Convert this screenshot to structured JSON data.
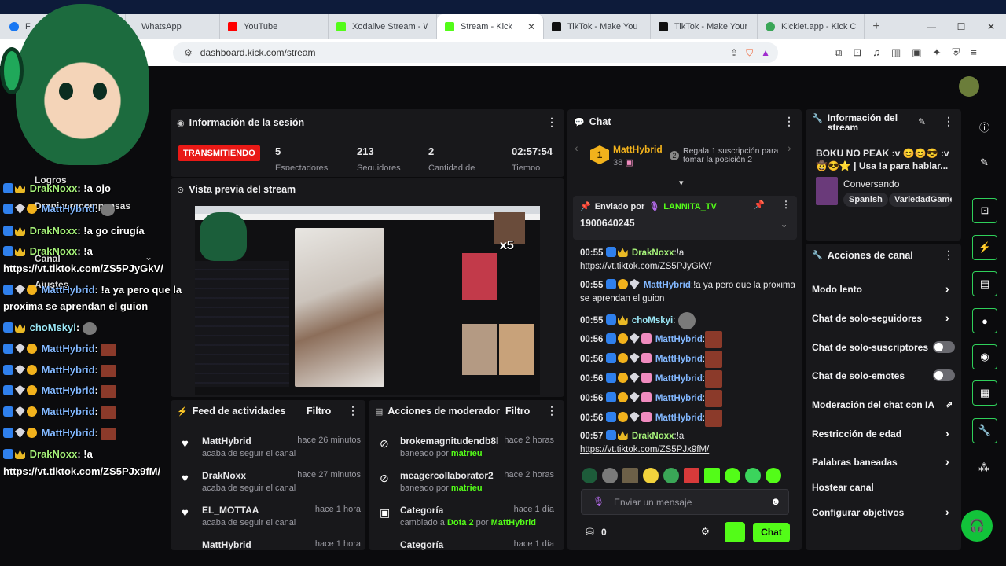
{
  "browser": {
    "tabs": [
      {
        "label": "F",
        "color": "#1877f2"
      },
      {
        "label": "WhatsApp",
        "color": "#25d366"
      },
      {
        "label": "YouTube",
        "color": "#ff0000"
      },
      {
        "label": "Xodalive Stream - Wa",
        "color": "#53fc18"
      },
      {
        "label": "Stream - Kick",
        "color": "#53fc18",
        "active": true
      },
      {
        "label": "TikTok - Make You",
        "color": "#111111"
      },
      {
        "label": "TikTok - Make Your D",
        "color": "#111111"
      },
      {
        "label": "Kicklet.app - Kick Cha",
        "color": "#3aa657"
      }
    ],
    "url": "dashboard.kick.com/stream"
  },
  "session": {
    "title": "Información de la sesión",
    "live_label": "TRANSMITIENDO",
    "stats": [
      {
        "value": "5",
        "label": "Espectadores"
      },
      {
        "value": "213",
        "label": "Seguidores"
      },
      {
        "value": "2",
        "label": "Cantidad de"
      },
      {
        "value": "02:57:54",
        "label": "Tiempo"
      }
    ]
  },
  "preview": {
    "title": "Vista previa del stream",
    "overlay_badge": "x5"
  },
  "activity": {
    "title": "Feed de actividades",
    "filter": "Filtro",
    "items": [
      {
        "name": "MattHybrid",
        "time": "hace 26 minutos",
        "desc": "acaba de seguir el canal"
      },
      {
        "name": "DrakNoxx",
        "time": "hace 27 minutos",
        "desc": "acaba de seguir el canal"
      },
      {
        "name": "EL_MOTTAA",
        "time": "hace 1 hora",
        "desc": "acaba de seguir el canal"
      },
      {
        "name": "MattHybrid",
        "time": "hace 1 hora",
        "desc": ""
      }
    ]
  },
  "mod": {
    "title": "Acciones de moderador",
    "filter": "Filtro",
    "items": [
      {
        "name": "brokemagnitudendb8l",
        "time": "hace 2 horas",
        "prefix": "baneado por ",
        "by": "matrieu",
        "extra": ""
      },
      {
        "name": "meagercollaborator2",
        "time": "hace 2 horas",
        "prefix": "baneado por ",
        "by": "matrieu",
        "extra": ""
      },
      {
        "name": "Categoría",
        "time": "hace 1 día",
        "prefix": "cambiado a ",
        "by": "Dota 2",
        "extra": " por ",
        "by2": "MattHybrid"
      },
      {
        "name": "Categoría",
        "time": "hace 1 día",
        "prefix": "",
        "by": "",
        "extra": ""
      }
    ]
  },
  "chat": {
    "title": "Chat",
    "top_gifter": {
      "name": "MattHybrid",
      "count": "38",
      "rank": "1"
    },
    "gift_msg": "Regala 1 suscripción para tomar la posición 2",
    "gift_rank": "2",
    "pinned": {
      "prefix": "Enviado por",
      "user": "LANNITA_TV",
      "text": "1900640245"
    },
    "messages": [
      {
        "time": "00:55",
        "user": "DrakNoxx",
        "text": ":!a",
        "link": "https://vt.tiktok.com/ZS5PJyGkV/"
      },
      {
        "time": "00:55",
        "user": "MattHybrid",
        "text": ":!a ya pero que la proxima se aprendan el guion"
      },
      {
        "time": "00:55",
        "user": "choMskyi",
        "text": ":"
      },
      {
        "time": "00:56",
        "user": "MattHybrid",
        "text": ":"
      },
      {
        "time": "00:56",
        "user": "MattHybrid",
        "text": ":"
      },
      {
        "time": "00:56",
        "user": "MattHybrid",
        "text": ":"
      },
      {
        "time": "00:56",
        "user": "MattHybrid",
        "text": ":"
      },
      {
        "time": "00:56",
        "user": "MattHybrid",
        "text": ":"
      },
      {
        "time": "00:57",
        "user": "DrakNoxx",
        "text": ":!a",
        "link": "https://vt.tiktok.com/ZS5PJx9fM/"
      }
    ],
    "placeholder": "Enviar un mensaje",
    "points": "0",
    "send": "Chat"
  },
  "stream_info": {
    "title": "Información del stream",
    "stream_title": "BOKU NO PEAK :v 😊😊😎 :v 🤠😎⭐ | Usa !a para hablar...",
    "category": "Conversando",
    "tags": [
      "Spanish",
      "VariedadGamer"
    ]
  },
  "channel_actions": {
    "title": "Acciones de canal",
    "items": [
      {
        "label": "Modo lento",
        "kind": "chevron"
      },
      {
        "label": "Chat de solo-seguidores",
        "kind": "chevron"
      },
      {
        "label": "Chat de solo-suscriptores",
        "kind": "toggle"
      },
      {
        "label": "Chat de solo-emotes",
        "kind": "toggle"
      },
      {
        "label": "Moderación del chat con IA",
        "kind": "external"
      },
      {
        "label": "Restricción de edad",
        "kind": "chevron"
      },
      {
        "label": "Palabras baneadas",
        "kind": "chevron"
      },
      {
        "label": "Hostear canal",
        "kind": "none"
      },
      {
        "label": "Configurar objetivos",
        "kind": "chevron"
      }
    ]
  },
  "overlay_chat": [
    {
      "user": "DrakNoxx",
      "text": ": !a ojo"
    },
    {
      "user": "MattHybrid",
      "text": ":"
    },
    {
      "user": "DrakNoxx",
      "text": ": !a go cirugía"
    },
    {
      "user": "DrakNoxx",
      "text": ": !a"
    },
    {
      "user": "",
      "text": "https://vt.tiktok.com/ZS5PJyGkV/"
    },
    {
      "user": "MattHybrid",
      "text": ": !a ya pero que la"
    },
    {
      "user": "",
      "text": "proxima se aprendan el guion"
    },
    {
      "user": "choMskyi",
      "text": ":"
    },
    {
      "user": "MattHybrid",
      "text": ":"
    },
    {
      "user": "MattHybrid",
      "text": ":"
    },
    {
      "user": "MattHybrid",
      "text": ":"
    },
    {
      "user": "MattHybrid",
      "text": ":"
    },
    {
      "user": "MattHybrid",
      "text": ":"
    },
    {
      "user": "DrakNoxx",
      "text": ": !a"
    },
    {
      "user": "",
      "text": "https://vt.tiktok.com/ZS5PJx9fM/"
    }
  ],
  "overlay_menu": [
    "Logros",
    "Dropi y recompensas",
    "Canal",
    "Ajustes"
  ],
  "colors": {
    "kick_green": "#53fc18",
    "live_red": "#e91916",
    "panel": "#18181b"
  }
}
